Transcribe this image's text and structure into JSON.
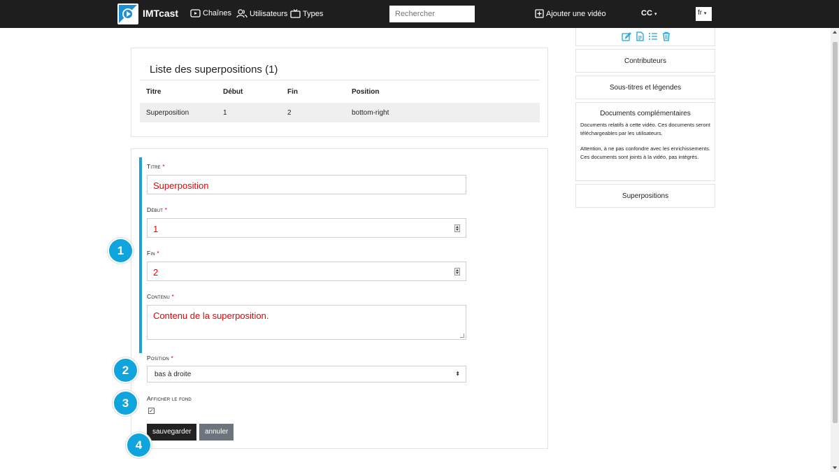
{
  "navbar": {
    "brand": "IMTcast",
    "links": [
      "Chaînes",
      "Utilisateurs",
      "Types"
    ],
    "search_placeholder": "Rechercher",
    "add_video": "Ajouter une vidéo",
    "cc": "CC",
    "lang": "fr"
  },
  "overlay_list": {
    "title": "Liste des superpositions (1)",
    "headers": [
      "Titre",
      "Début",
      "Fin",
      "Position"
    ],
    "rows": [
      [
        "Superposition",
        "1",
        "2",
        "bottom-right"
      ]
    ]
  },
  "form": {
    "title_label": "Titre",
    "title_value": "Superposition",
    "start_label": "Début",
    "start_value": "1",
    "end_label": "Fin",
    "end_value": "2",
    "content_label": "Contenu",
    "content_value": "Contenu de la superposition.",
    "position_label": "Position",
    "position_value": "bas à droite",
    "background_label": "Afficher le fond",
    "background_checked": true,
    "required_mark": "*",
    "save_label": "sauvegarder",
    "cancel_label": "annuler"
  },
  "callouts": [
    "1",
    "2",
    "3",
    "4"
  ],
  "sidebar": {
    "icons": [
      "edit-icon",
      "document-icon",
      "list-icon",
      "trash-icon"
    ],
    "contributors": "Contributeurs",
    "subtitles": "Sous-titres et légendes",
    "docs_title": "Documents complémentaires",
    "docs_text_1": "Documents relatifs à cette vidéo. Ces documents seront téléchargeables par les utilisateurs.",
    "docs_text_2": "Attention, à ne pas confondre avec les enrichissements. Ces documents sont joints à la vidéo, pas intégrés.",
    "overlays": "Superpositions"
  },
  "colors": {
    "navbar": "#1e1e1e",
    "accent": "#1aa3d9",
    "field_text": "#e00000",
    "save_button": "#222222",
    "cancel_button": "#6c757d"
  }
}
